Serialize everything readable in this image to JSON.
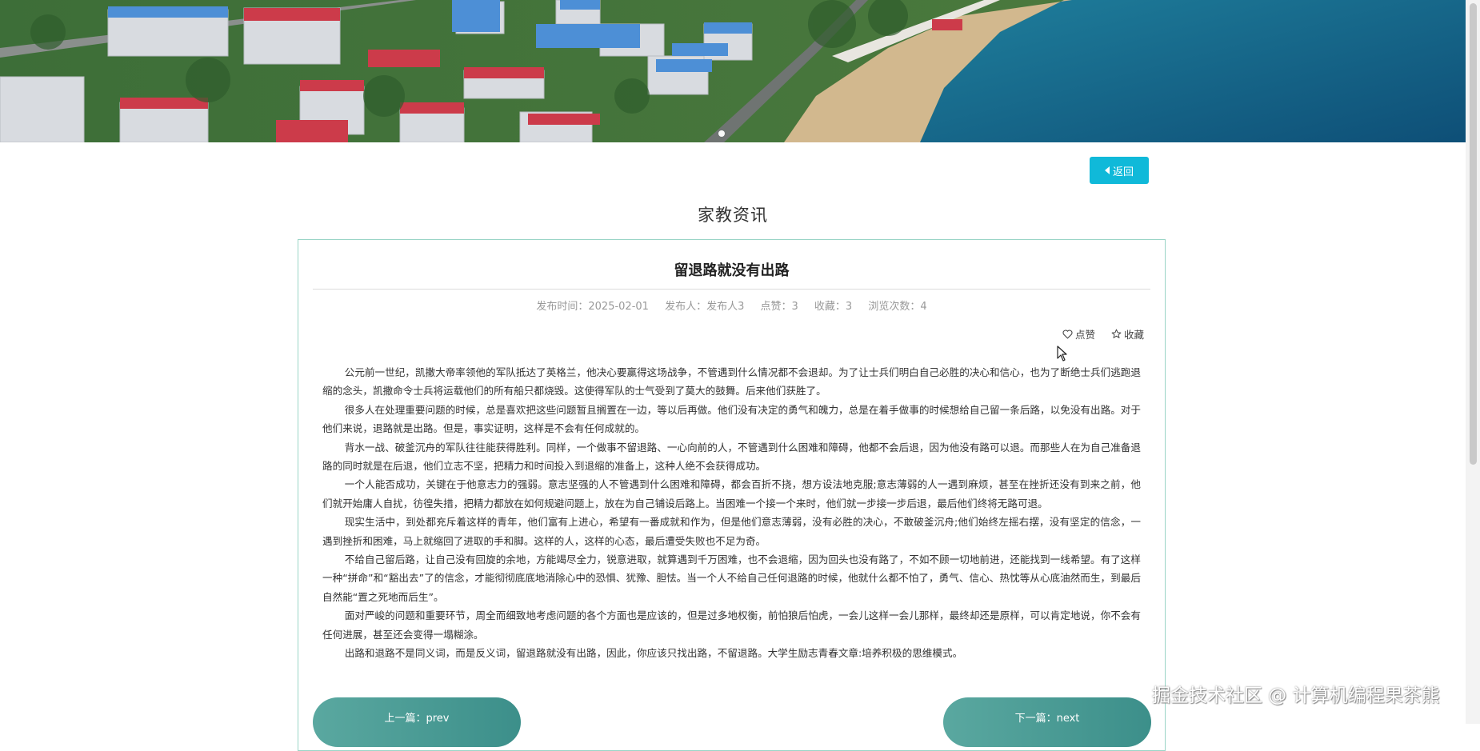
{
  "banner": {
    "description_icon": "coastal-town-photo-icon"
  },
  "back_button": {
    "label": "返回",
    "icon": "caret-left-icon"
  },
  "section_title": "家教资讯",
  "article": {
    "title": "留退路就没有出路",
    "meta": {
      "publish_time": "发布时间：2025-02-01",
      "publisher": "发布人：发布人3",
      "likes": "点赞：3",
      "favorites": "收藏：3",
      "views": "浏览次数：4"
    },
    "actions": {
      "like": "点赞",
      "favorite": "收藏"
    },
    "paragraphs": [
      "公元前一世纪，凯撒大帝率领他的军队抵达了英格兰，他决心要赢得这场战争，不管遇到什么情况都不会退却。为了让士兵们明白自己必胜的决心和信心，也为了断绝士兵们逃跑退缩的念头，凯撒命令士兵将运载他们的所有船只都烧毁。这使得军队的士气受到了莫大的鼓舞。后来他们获胜了。",
      "很多人在处理重要问题的时候，总是喜欢把这些问题暂且搁置在一边，等以后再做。他们没有决定的勇气和魄力，总是在着手做事的时候想给自己留一条后路，以免没有出路。对于他们来说，退路就是出路。但是，事实证明，这样是不会有任何成就的。",
      "背水一战、破釜沉舟的军队往往能获得胜利。同样，一个做事不留退路、一心向前的人，不管遇到什么困难和障碍，他都不会后退，因为他没有路可以退。而那些人在为自己准备退路的同时就是在后退，他们立志不坚，把精力和时间投入到退缩的准备上，这种人绝不会获得成功。",
      "一个人能否成功，关键在于他意志力的强弱。意志坚强的人不管遇到什么困难和障碍，都会百折不挠，想方设法地克服;意志薄弱的人一遇到麻烦，甚至在挫折还没有到来之前，他们就开始庸人自扰，彷徨失措，把精力都放在如何规避问题上，放在为自己铺设后路上。当困难一个接一个来时，他们就一步接一步后退，最后他们终将无路可退。",
      "现实生活中，到处都充斥着这样的青年，他们富有上进心，希望有一番成就和作为，但是他们意志薄弱，没有必胜的决心，不敢破釜沉舟;他们始终左摇右摆，没有坚定的信念，一遇到挫折和困难，马上就缩回了进取的手和脚。这样的人，这样的心态，最后遭受失败也不足为奇。",
      "不给自己留后路，让自己没有回旋的余地，方能竭尽全力，锐意进取，就算遇到千万困难，也不会退缩，因为回头也没有路了，不如不顾一切地前进，还能找到一线希望。有了这样一种“拼命”和“豁出去”了的信念，才能彻彻底底地消除心中的恐惧、犹豫、胆怯。当一个人不给自己任何退路的时候，他就什么都不怕了，勇气、信心、热忱等从心底油然而生，到最后自然能“置之死地而后生”。",
      "面对严峻的问题和重要环节，周全而细致地考虑问题的各个方面也是应该的，但是过多地权衡，前怕狼后怕虎，一会儿这样一会儿那样，最终却还是原样，可以肯定地说，你不会有任何进展，甚至还会变得一塌糊涂。",
      "出路和退路不是同义词，而是反义词，留退路就没有出路，因此，你应该只找出路，不留退路。大学生励志青春文章:培养积极的思维模式。"
    ]
  },
  "pager": {
    "prev": "上一篇：prev",
    "next": "下一篇：next"
  },
  "watermark": "掘金技术社区 @ 计算机编程果茶熊",
  "colors": {
    "accent": "#10b9d9",
    "card_border": "#9ad5c7",
    "pager": "#4a9b95"
  }
}
